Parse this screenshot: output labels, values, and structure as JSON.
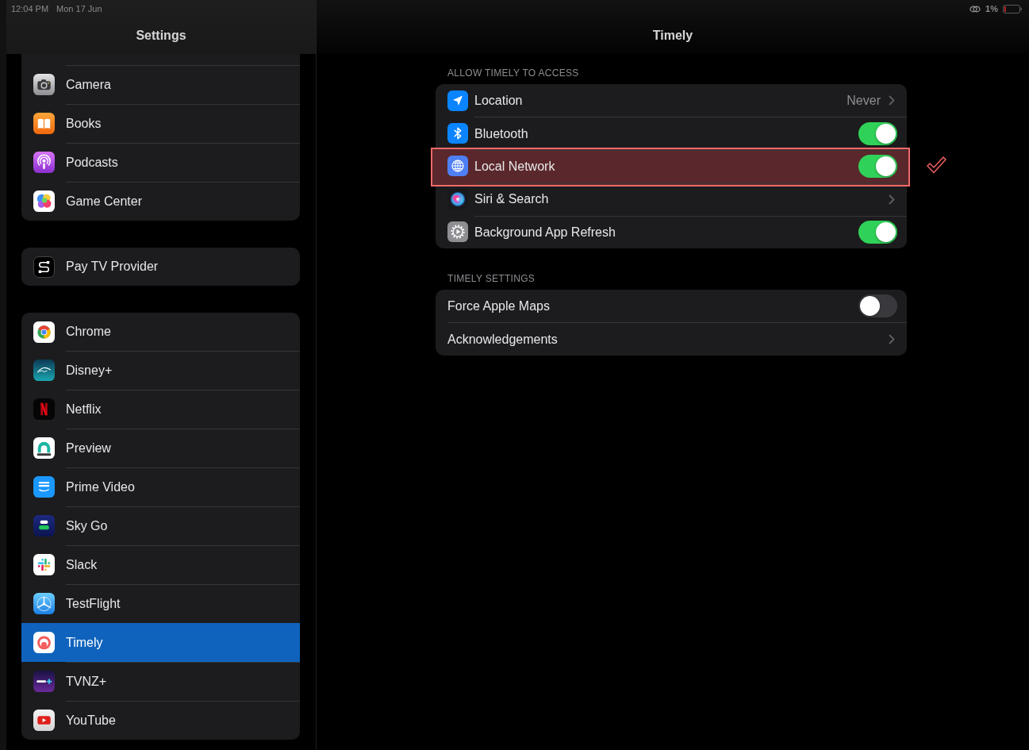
{
  "status_bar": {
    "time": "12:04 PM",
    "date": "Mon 17 Jun",
    "battery_percent": "1%"
  },
  "sidebar": {
    "title": "Settings",
    "groups": [
      {
        "items": [
          {
            "label": "Camera",
            "selected": false
          },
          {
            "label": "Books",
            "selected": false
          },
          {
            "label": "Podcasts",
            "selected": false
          },
          {
            "label": "Game Center",
            "selected": false
          }
        ]
      },
      {
        "items": [
          {
            "label": "Pay TV Provider",
            "selected": false
          }
        ]
      },
      {
        "items": [
          {
            "label": "Chrome",
            "selected": false
          },
          {
            "label": "Disney+",
            "selected": false
          },
          {
            "label": "Netflix",
            "selected": false
          },
          {
            "label": "Preview",
            "selected": false
          },
          {
            "label": "Prime Video",
            "selected": false
          },
          {
            "label": "Sky Go",
            "selected": false
          },
          {
            "label": "Slack",
            "selected": false
          },
          {
            "label": "TestFlight",
            "selected": false
          },
          {
            "label": "Timely",
            "selected": true
          },
          {
            "label": "TVNZ+",
            "selected": false
          },
          {
            "label": "YouTube",
            "selected": false
          }
        ]
      }
    ]
  },
  "detail": {
    "title": "Timely",
    "sections": [
      {
        "header": "ALLOW TIMELY TO ACCESS",
        "rows": [
          {
            "kind": "link",
            "label": "Location",
            "value": "Never",
            "highlighted": false
          },
          {
            "kind": "toggle",
            "label": "Bluetooth",
            "on": true,
            "highlighted": false
          },
          {
            "kind": "toggle",
            "label": "Local Network",
            "on": true,
            "highlighted": true
          },
          {
            "kind": "link",
            "label": "Siri & Search",
            "highlighted": false
          },
          {
            "kind": "toggle",
            "label": "Background App Refresh",
            "on": true,
            "highlighted": false
          }
        ]
      },
      {
        "header": "TIMELY SETTINGS",
        "rows": [
          {
            "kind": "toggle",
            "label": "Force Apple Maps",
            "on": false,
            "highlighted": false
          },
          {
            "kind": "link",
            "label": "Acknowledgements",
            "highlighted": false
          }
        ]
      }
    ]
  }
}
